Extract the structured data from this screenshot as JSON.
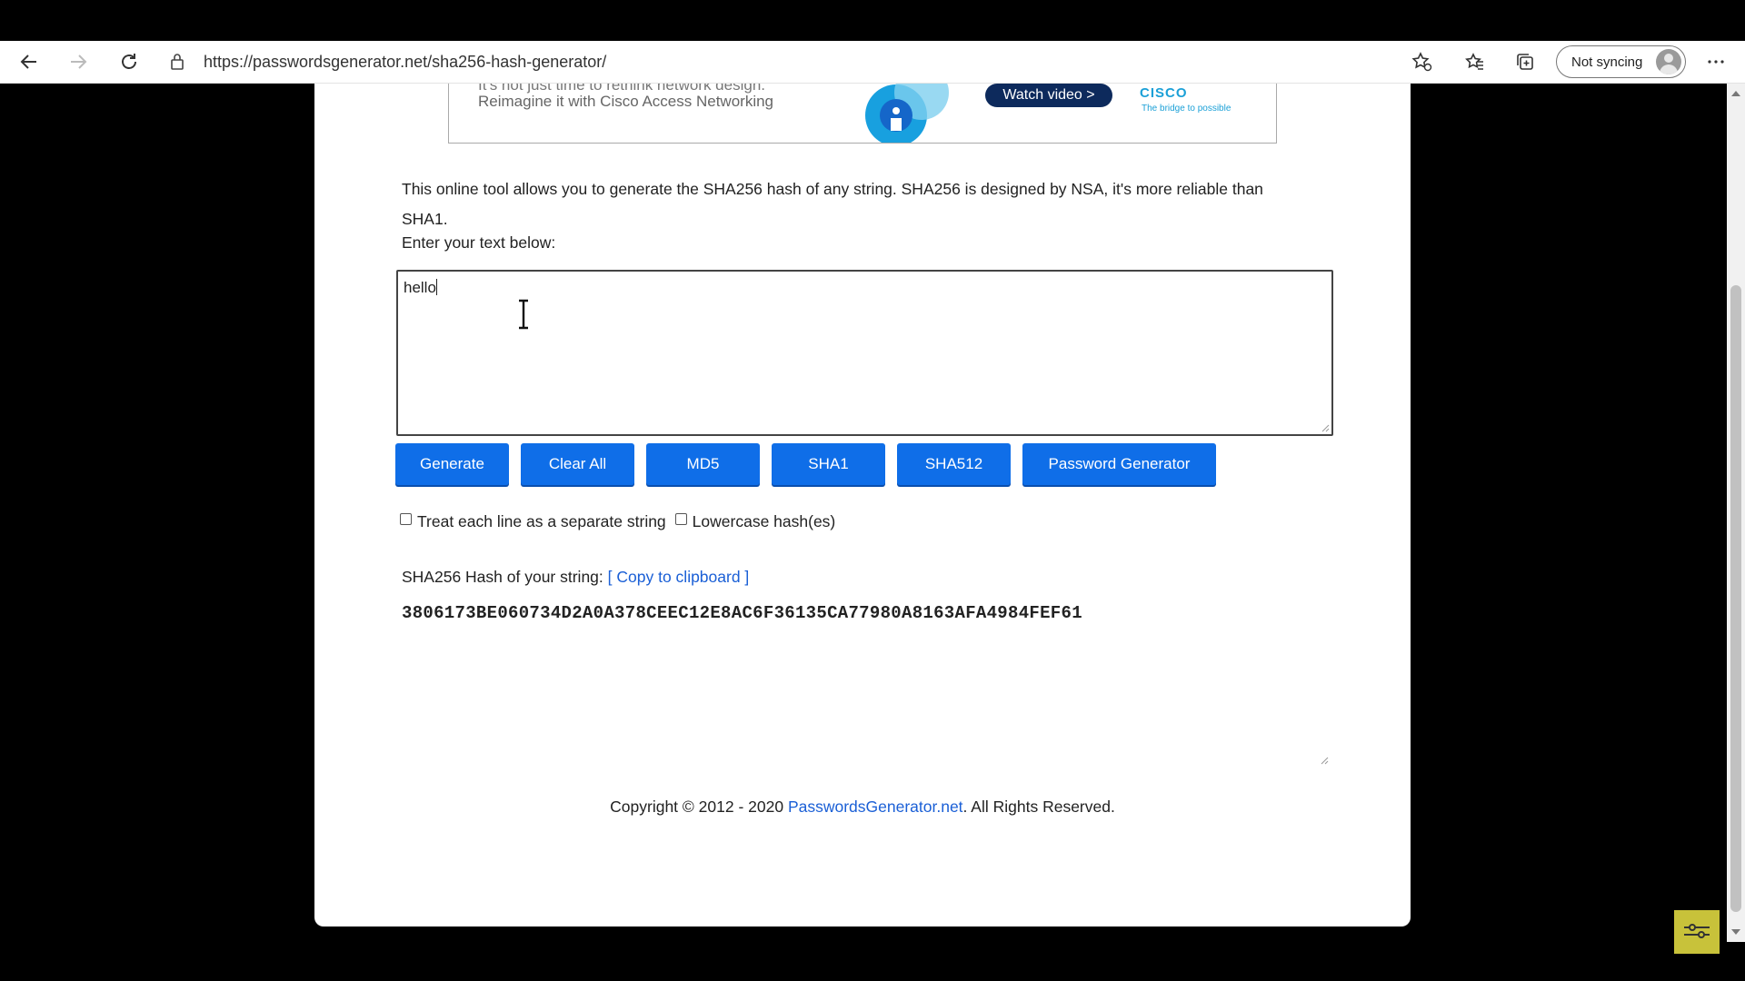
{
  "browser": {
    "url": "https://passwordsgenerator.net/sha256-hash-generator/",
    "sync_label": "Not syncing"
  },
  "ad": {
    "line1": "It's not just time to rethink network design.",
    "line2": "Reimagine it with Cisco Access Networking",
    "watch_label": "Watch video >",
    "brand": "CISCO",
    "tagline": "The bridge to possible"
  },
  "page": {
    "description": "This online tool allows you to generate the SHA256 hash of any string. SHA256 is designed by NSA, it's more reliable than SHA1.",
    "prompt": "Enter your text below:",
    "input_value": "hello",
    "buttons": {
      "generate": "Generate",
      "clear_all": "Clear All",
      "md5": "MD5",
      "sha1": "SHA1",
      "sha512": "SHA512",
      "password_generator": "Password Generator"
    },
    "options": {
      "separate_lines": "Treat each line as a separate string",
      "lowercase": "Lowercase hash(es)"
    },
    "result_label": "SHA256 Hash of your string:",
    "copy_label": "[ Copy to clipboard ]",
    "hash": "3806173BE060734D2A0A378CEEC12E8AC6F36135CA77980A8163AFA4984FEF61",
    "footer": {
      "prefix": "Copyright © 2012 - 2020 ",
      "link": "PasswordsGenerator.net",
      "suffix": ". All Rights Reserved."
    }
  },
  "colors": {
    "button_blue": "#0f6ee8",
    "link_blue": "#1a5fd6"
  }
}
